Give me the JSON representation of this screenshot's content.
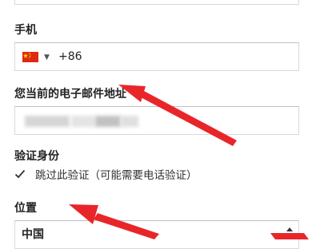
{
  "form": {
    "phone": {
      "label": "手机",
      "country_code": "+86",
      "flag_icon": "china-flag-icon"
    },
    "email": {
      "label": "您当前的电子邮件地址"
    },
    "verify": {
      "label": "验证身份",
      "skip_label": "跳过此验证（可能需要电话验证）",
      "skip_checked": true
    },
    "location": {
      "label": "位置",
      "selected": "中国"
    }
  },
  "annotations": {
    "arrow_color": "#e8262a",
    "arrow_count": 3
  }
}
